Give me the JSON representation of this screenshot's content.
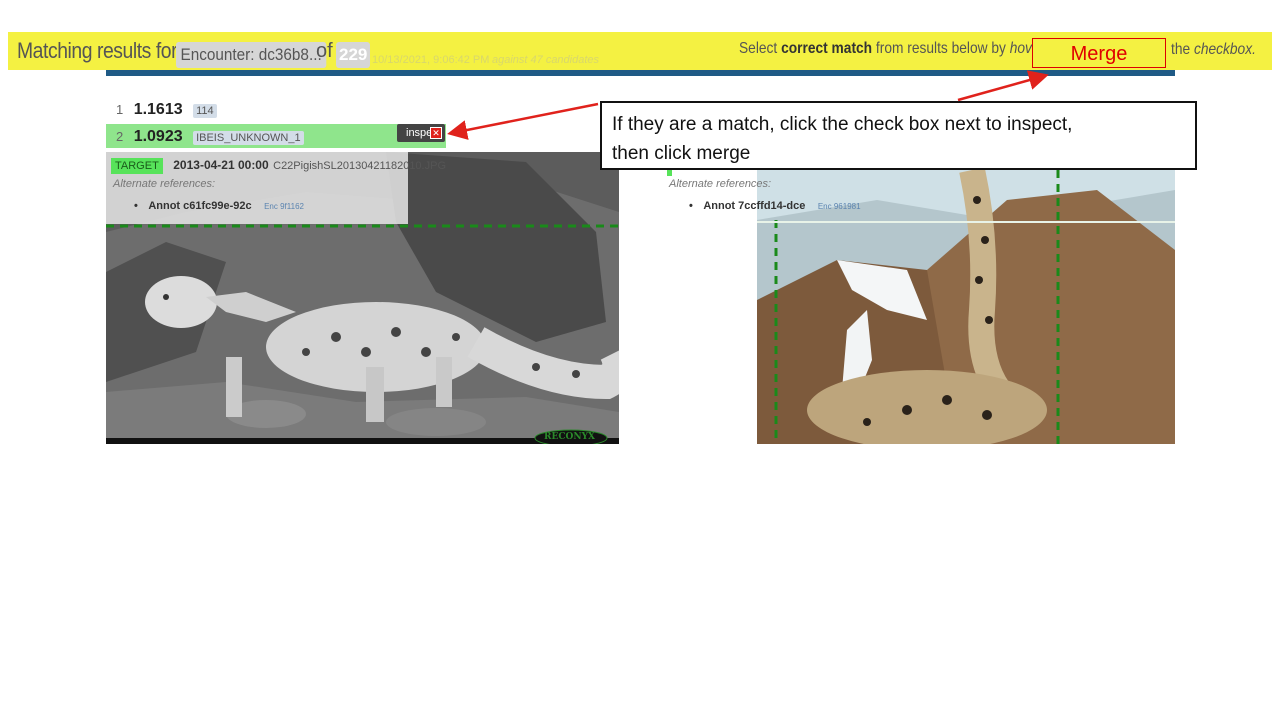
{
  "header": {
    "title": "Matching results for",
    "encounter_chip": "Encounter: dc36b8...",
    "of_text": "of",
    "count": "229",
    "faint_timestamp": "10/13/2021, 9:06:42 PM",
    "faint_candidates": "against 47 candidates",
    "instruction_pre": "Select ",
    "instruction_bold": "correct match",
    "instruction_mid": " from results below by ",
    "instruction_italic": "hovering",
    "instruction_end_pre": "the ",
    "instruction_end_italic": "checkbox."
  },
  "merge_label": "Merge",
  "results": [
    {
      "rank": "1",
      "score": "1.1613",
      "chip": "114"
    },
    {
      "rank": "2",
      "score": "1.0923",
      "chip": "IBEIS_UNKNOWN_1",
      "inspect_label": "inspect",
      "checkbox_glyph": "✕"
    }
  ],
  "left_image": {
    "target_tag": "TARGET",
    "datetime": "2013-04-21 00:00",
    "filename": "C22PigishSL20130421182010.JPG",
    "alt_refs_label": "Alternate references:",
    "annot": "Annot c61fc99e-92c",
    "enc": "Enc 9f1162",
    "watermark": "RECONYX"
  },
  "right_image": {
    "alt_refs_label": "Alternate references:",
    "annot": "Annot 7ccffd14-dce",
    "enc": "Enc 961981"
  },
  "callout": {
    "line1": "If they are a match, click the check box next to inspect,",
    "line2": "then click merge"
  },
  "colors": {
    "header_yellow": "#f4f142",
    "accent_blue": "#1f5a86",
    "match_green": "#8fe58c",
    "arrow_red": "#e0221c"
  }
}
